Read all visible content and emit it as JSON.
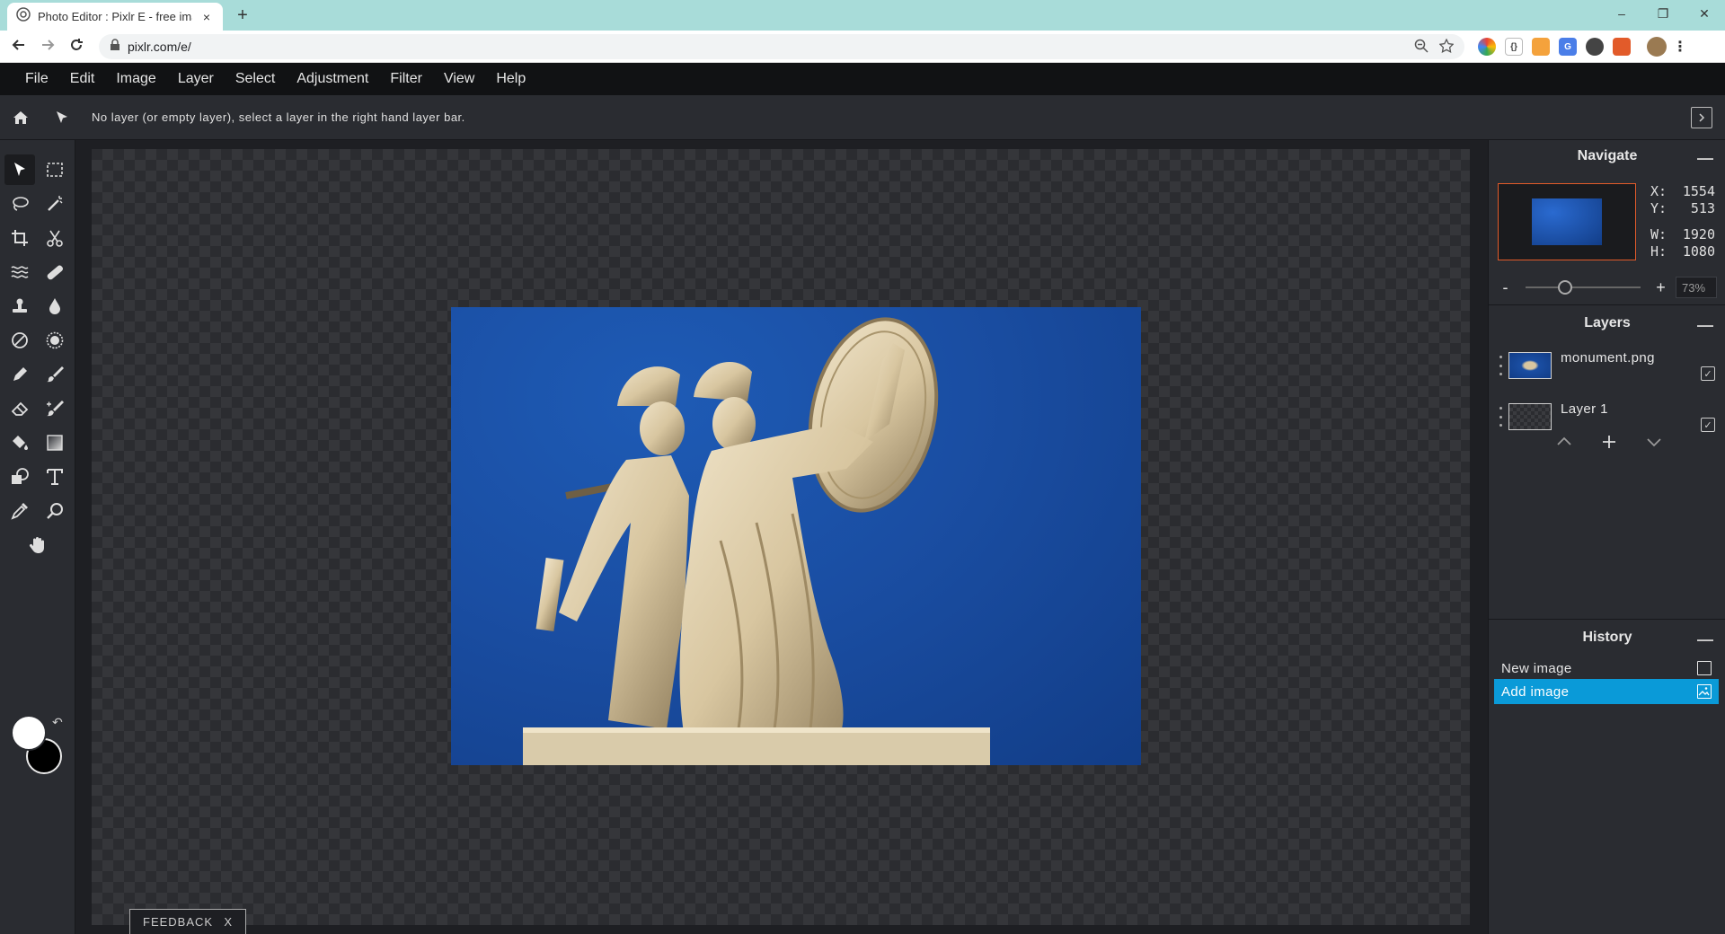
{
  "browser": {
    "tab_title": "Photo Editor : Pixlr E - free image editor",
    "tab_close": "×",
    "new_tab": "+",
    "url": "pixlr.com/e/",
    "minimize": "–",
    "restore": "❐",
    "close": "✕"
  },
  "menu": [
    "File",
    "Edit",
    "Image",
    "Layer",
    "Select",
    "Adjustment",
    "Filter",
    "View",
    "Help"
  ],
  "options_bar": {
    "message": "No layer (or empty layer), select a layer in the right hand layer bar."
  },
  "colors": {
    "foreground": "#ffffff",
    "background": "#000000",
    "accent": "#0a9ad8",
    "nav_border": "#e25b2a"
  },
  "navigate": {
    "title": "Navigate",
    "x_label": "X:",
    "x_value": "1554",
    "y_label": "Y:",
    "y_value": "513",
    "w_label": "W:",
    "w_value": "1920",
    "h_label": "H:",
    "h_value": "1080",
    "zoom_minus": "-",
    "zoom_plus": "+",
    "zoom_value": "73%"
  },
  "layers": {
    "title": "Layers",
    "items": [
      {
        "name": "monument.png"
      },
      {
        "name": "Layer 1"
      }
    ]
  },
  "history": {
    "title": "History",
    "items": [
      {
        "label": "New image"
      },
      {
        "label": "Add image"
      }
    ]
  },
  "feedback": {
    "label": "FEEDBACK",
    "close": "X"
  }
}
